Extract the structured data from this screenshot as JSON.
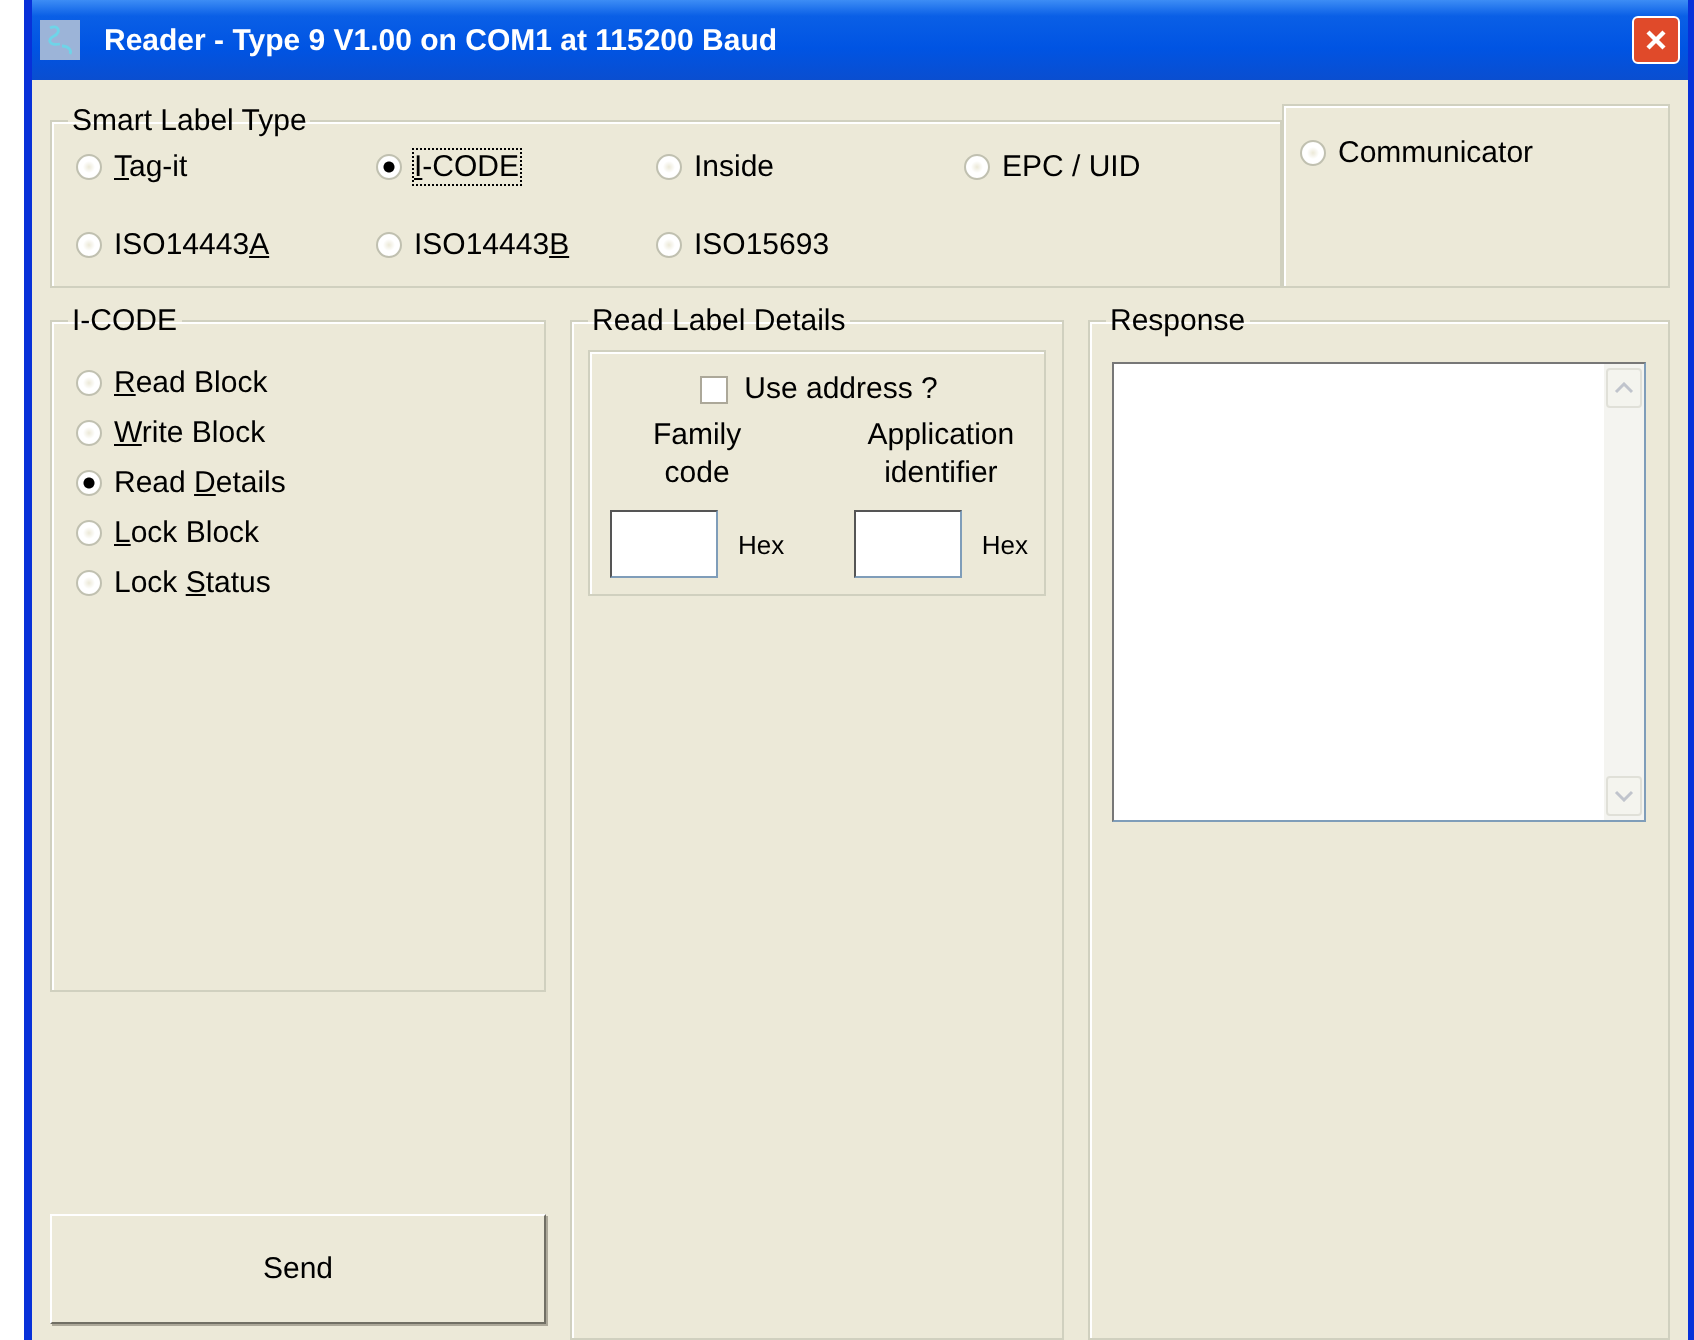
{
  "window": {
    "title": "Reader - Type 9 V1.00 on COM1 at 115200 Baud"
  },
  "smart_label_type": {
    "legend": "Smart Label Type",
    "options": [
      {
        "mnemonic": "T",
        "after": "ag-it",
        "selected": false
      },
      {
        "mnemonic": "I",
        "after": "-CODE",
        "selected": true
      },
      {
        "label": "Inside",
        "selected": false
      },
      {
        "label": "EPC / UID",
        "selected": false
      },
      {
        "before": "ISO14443",
        "mnemonic": "A",
        "selected": false
      },
      {
        "before": "ISO14443",
        "mnemonic": "B",
        "selected": false
      },
      {
        "label": "ISO15693",
        "selected": false
      }
    ],
    "extra": {
      "label": "Communicator",
      "selected": false
    }
  },
  "icode": {
    "legend": "I-CODE",
    "options": [
      {
        "mnemonic": "R",
        "after": "ead Block",
        "selected": false
      },
      {
        "mnemonic": "W",
        "after": "rite Block",
        "selected": false
      },
      {
        "before": "Read ",
        "mnemonic": "D",
        "after": "etails",
        "selected": true
      },
      {
        "mnemonic": "L",
        "after": "ock Block",
        "selected": false
      },
      {
        "before": "Lock ",
        "mnemonic": "S",
        "after": "tatus",
        "selected": false
      }
    ]
  },
  "send_button": "Send",
  "read_label_details": {
    "legend": "Read Label Details",
    "use_address": {
      "label": "Use address ?",
      "checked": false
    },
    "fields": [
      {
        "label": "Family code",
        "unit": "Hex"
      },
      {
        "label": "Application identifier",
        "unit": "Hex"
      }
    ]
  },
  "response": {
    "legend": "Response"
  }
}
